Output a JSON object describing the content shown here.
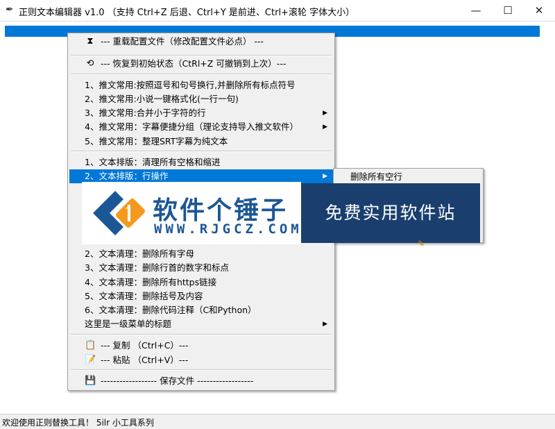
{
  "window": {
    "title": "正则文本编辑器 v1.0 （支持 Ctrl+Z 后退、Ctrl+Y 是前进、Ctrl+滚轮 字体大小）",
    "title_icon": "feather-pen-icon",
    "minimize": "—",
    "maximize": "☐",
    "close": "✕"
  },
  "menu": {
    "items": [
      {
        "id": "reload",
        "icon": "⧗",
        "icon_name": "hourglass-icon",
        "label": "--- 重载配置文件（修改配置文件必点） ---"
      },
      {
        "id": "restore",
        "icon": "⟲",
        "icon_name": "restore-icon",
        "label": "--- 恢复到初始状态（CtRl+Z 可撤销到上次）---"
      },
      {
        "id": "tw1",
        "label": "1、推文常用:按照逗号和句号换行,并删除所有标点符号"
      },
      {
        "id": "tw2",
        "label": "2、推文常用:小说一键格式化(一行一句)"
      },
      {
        "id": "tw3",
        "label": "3、推文常用:合并小于字符的行",
        "arrow": "▶"
      },
      {
        "id": "tw4",
        "label": "4、推文常用：字幕便捷分组（理论支持导入推文软件）",
        "arrow": "▶"
      },
      {
        "id": "tw5",
        "label": "5、推文常用：整理SRT字幕为纯文本"
      },
      {
        "id": "lay1",
        "label": "1、文本排版：清理所有空格和缩进"
      },
      {
        "id": "lay2",
        "label": "2、文本排版：行操作",
        "arrow": "▶"
      },
      {
        "id": "cl2",
        "label": "2、文本清理：删除所有字母"
      },
      {
        "id": "cl3",
        "label": "3、文本清理：删除行首的数字和标点"
      },
      {
        "id": "cl4",
        "label": "4、文本清理：删除所有https链接"
      },
      {
        "id": "cl5",
        "label": "5、文本清理：删除括号及内容"
      },
      {
        "id": "cl6",
        "label": "6、文本清理：删除代码注释（C和Python）"
      },
      {
        "id": "lvl1",
        "label": "这里是一级菜单的标题",
        "arrow": "▶"
      },
      {
        "id": "copy",
        "icon": "📋",
        "icon_name": "clipboard-icon",
        "label": "--- 复制 （Ctrl+C）---"
      },
      {
        "id": "paste",
        "icon": "📝",
        "icon_name": "paste-icon",
        "label": "--- 粘贴 （Ctrl+V）---"
      },
      {
        "id": "save",
        "icon": "💾",
        "icon_name": "save-disk-icon",
        "label": "------------------ 保存文件 ------------------"
      }
    ]
  },
  "submenu": {
    "items": [
      "删除所有空行"
    ],
    "partial_glyphs": [
      ")",
      ")",
      ")"
    ]
  },
  "watermark": {
    "title": "软件个锤子",
    "url": "WWW.RJGCZ.COM",
    "slogan": "免费实用软件站",
    "colors": {
      "brand": "#1c5795",
      "orange": "#f39a1e",
      "panel": "#1a3f6e"
    }
  },
  "status": {
    "text": "欢迎使用正则替换工具！ 5ilr 小工具系列"
  },
  "colors": {
    "selection": "#0078d7",
    "menu_bg": "#f0f0f0"
  }
}
